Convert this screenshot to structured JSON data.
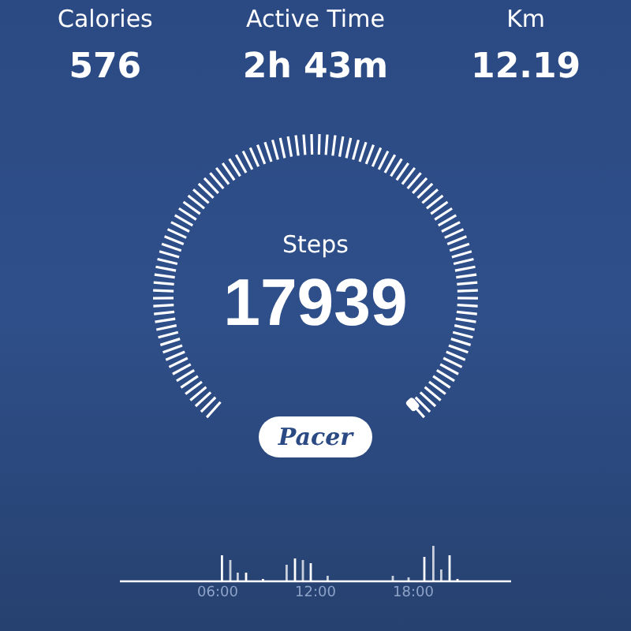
{
  "stats": [
    {
      "label": "Calories",
      "value": "576"
    },
    {
      "label": "Active Time",
      "value": "2h 43m"
    },
    {
      "label": "Km",
      "value": "12.19"
    }
  ],
  "gauge": {
    "label": "Steps",
    "value": "17939"
  },
  "brand": "Pacer",
  "activity": {
    "time_labels": [
      "06:00",
      "12:00",
      "18:00"
    ]
  }
}
